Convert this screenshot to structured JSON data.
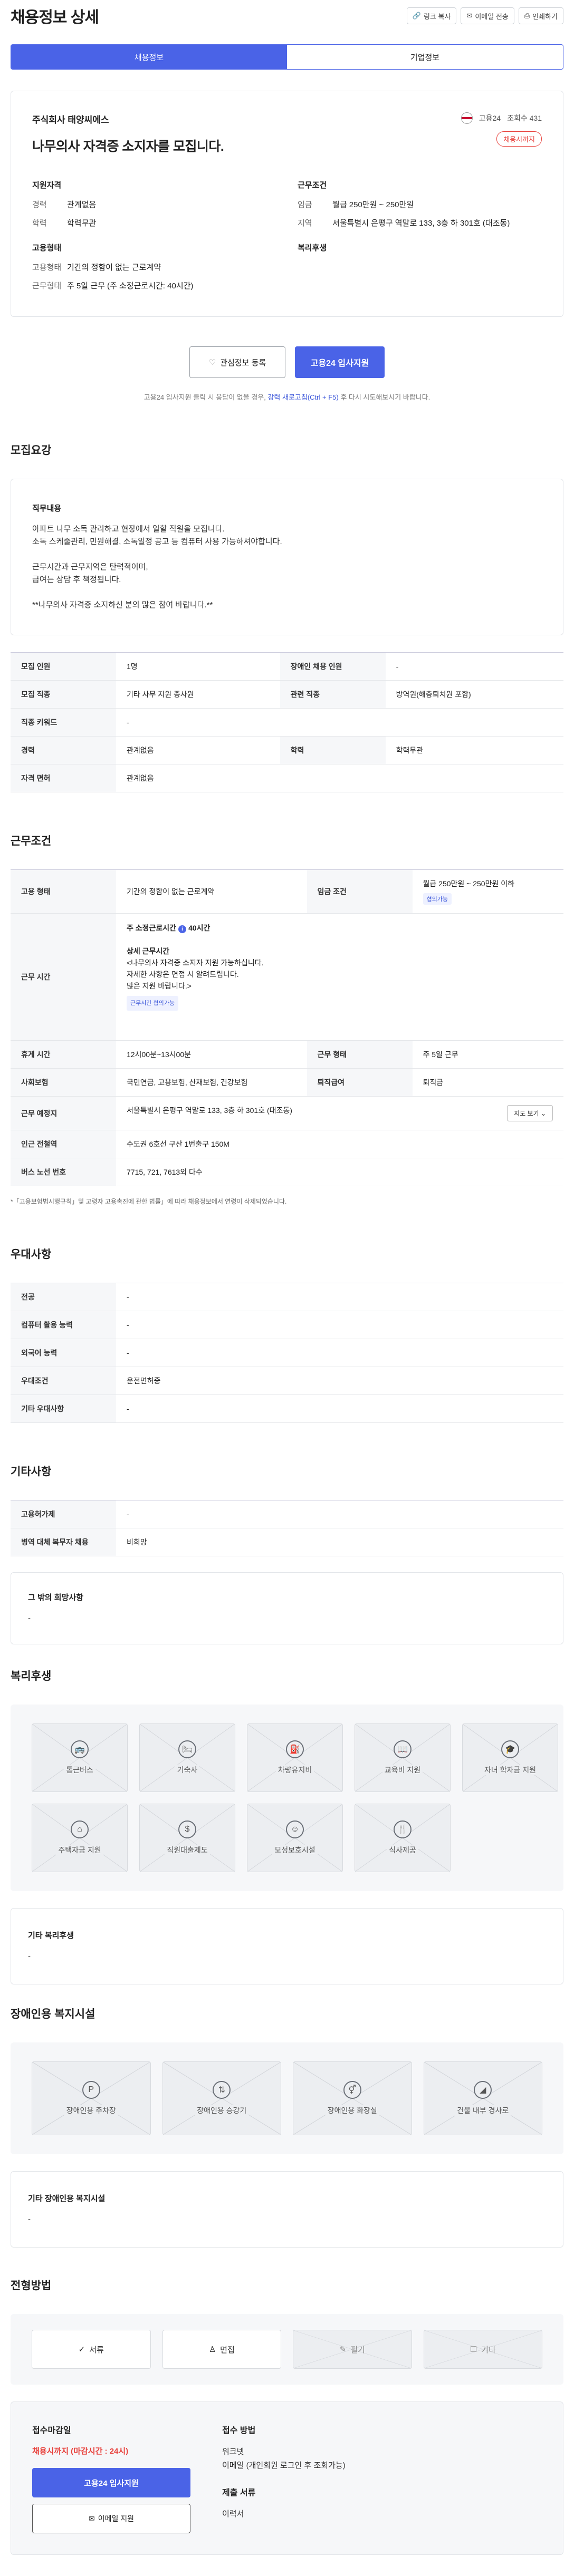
{
  "header": {
    "title": "채용정보 상세",
    "link_copy": "링크 복사",
    "email_send": "이메일 전송",
    "print": "인쇄하기"
  },
  "tabs": [
    "채용정보",
    "기업정보"
  ],
  "summary": {
    "company": "주식회사 태양씨에스",
    "title": "나무의사 자격증 소지자를 모집니다.",
    "worknet_label": "고용24",
    "views": "조회수 431",
    "badge": "채용시까지",
    "qual_title": "지원자격",
    "qual": [
      {
        "k": "경력",
        "v": "관계없음"
      },
      {
        "k": "학력",
        "v": "학력무관"
      }
    ],
    "cond_title": "근무조건",
    "cond": [
      {
        "k": "임금",
        "v": "월급 250만원 ~ 250만원"
      },
      {
        "k": "지역",
        "v": "서울특별시 은평구 역말로 133, 3층 하 301호 (대조동)"
      }
    ],
    "emp_title": "고용형태",
    "emp": [
      {
        "k": "고용형태",
        "v": "기간의 정함이 없는 근로계약"
      },
      {
        "k": "근무형태",
        "v": "주 5일 근무 (주 소정근로시간: 40시간)"
      }
    ],
    "welfare_title": "복리후생"
  },
  "actions": {
    "interest": "관심정보 등록",
    "apply": "고용24 입사지원"
  },
  "notice": {
    "pre": "고용24 입사지원 클릭 시 응답이 없을 경우, ",
    "link": "강력 새로고침(Ctrl + F5)",
    "post": " 후 다시 시도해보시기 바랍니다."
  },
  "recruit": {
    "section": "모집요강",
    "job_label": "직무내용",
    "job_lines": [
      "아파트 나무 소독 관리하고 현장에서 일할 직원을 모집니다.",
      "소독 스케줄관리, 민원해결, 소독일정 공고 등 컴퓨터 사용 가능하셔야합니다.",
      "",
      "근무시간과 근무지역은 탄력적이며,",
      "급여는 상담 후 책정됩니다.",
      "",
      "**나무의사 자격증 소지하신 분의 많은 참여 바랍니다.**"
    ],
    "rows": [
      [
        "모집 인원",
        "1명",
        "장애인 채용 인원",
        "-"
      ],
      [
        "모집 직종",
        "기타 사무 지원 종사원",
        "관련 직종",
        "방역원(해충퇴치원 포함)"
      ],
      [
        "직종 키워드",
        "-",
        "",
        ""
      ],
      [
        "경력",
        "관계없음",
        "학력",
        "학력무관"
      ],
      [
        "자격 면허",
        "관계없음",
        "",
        ""
      ]
    ]
  },
  "conditions": {
    "section": "근무조건",
    "emp_type_k": "고용 형태",
    "emp_type_v": "기간의 정함이 없는 근로계약",
    "wage_k": "임금 조건",
    "wage_v": "월급 250만원 ~ 250만원 이하",
    "wage_tag": "협의가능",
    "time_k": "근무 시간",
    "time_top": "주 소정근로시간",
    "time_hours": "40시간",
    "time_detail_title": "상세 근무시간",
    "time_lines": [
      "<나무의사 자격증 소지자 지원 가능하십니다.",
      "자세한 사항은 면접 시 알려드립니다.",
      "많은 지원 바랍니다.>"
    ],
    "time_tag": "근무시간 협의가능",
    "rows": [
      [
        "휴게 시간",
        "12시00분~13시00분",
        "근무 형태",
        "주 5일 근무"
      ],
      [
        "사회보험",
        "국민연금, 고용보험, 산재보험, 건강보험",
        "퇴직급여",
        "퇴직금"
      ]
    ],
    "place_k": "근무 예정지",
    "place_v": "서울특별시 은평구 역말로 133, 3층 하 301호 (대조동)",
    "map_btn": "지도 보기",
    "subway_k": "인근 전철역",
    "subway_v": "수도권 6호선 구산 1번출구 150M",
    "bus_k": "버스 노선 번호",
    "bus_v": "7715, 721, 7613외 다수",
    "footnote": "*「고용보험법시행규칙」및 고령자 고용촉진에 관한 법률」에 따라 채용정보에서 연령이 삭제되었습니다."
  },
  "preference": {
    "section": "우대사항",
    "rows": [
      [
        "전공",
        "-"
      ],
      [
        "컴퓨터 활용 능력",
        "-"
      ],
      [
        "외국어 능력",
        "-"
      ],
      [
        "우대조건",
        "운전면허증"
      ],
      [
        "기타 우대사항",
        "-"
      ]
    ]
  },
  "etc": {
    "section": "기타사항",
    "rows": [
      [
        "고용허가제",
        "-"
      ],
      [
        "병역 대체 복무자 채용",
        "비희망"
      ]
    ],
    "other_title": "그 밖의 희망사항",
    "other_value": "-"
  },
  "welfare": {
    "section": "복리후생",
    "items": [
      {
        "label": "통근버스",
        "icon": "bus-icon",
        "glyph": "🚌"
      },
      {
        "label": "기숙사",
        "icon": "bed-icon",
        "glyph": "🛏"
      },
      {
        "label": "차량유지비",
        "icon": "fuel-icon",
        "glyph": "⛽"
      },
      {
        "label": "교육비 지원",
        "icon": "book-icon",
        "glyph": "📖"
      },
      {
        "label": "자녀 학자금 지원",
        "icon": "graduation-icon",
        "glyph": "🎓"
      },
      {
        "label": "주택자금 지원",
        "icon": "house-icon",
        "glyph": "⌂"
      },
      {
        "label": "직원대출제도",
        "icon": "money-bag-icon",
        "glyph": "$"
      },
      {
        "label": "모성보호시설",
        "icon": "baby-icon",
        "glyph": "☺"
      },
      {
        "label": "식사제공",
        "icon": "meal-icon",
        "glyph": "🍴"
      }
    ],
    "other_title": "기타 복리후생",
    "other_value": "-"
  },
  "disability": {
    "section": "장애인용 복지시설",
    "items": [
      {
        "label": "장애인용 주차장",
        "icon": "parking-icon",
        "glyph": "P"
      },
      {
        "label": "장애인용 승강기",
        "icon": "elevator-icon",
        "glyph": "⇅"
      },
      {
        "label": "장애인용 화장실",
        "icon": "restroom-icon",
        "glyph": "⚥"
      },
      {
        "label": "건물 내부 경사로",
        "icon": "ramp-icon",
        "glyph": "◢"
      }
    ],
    "other_title": "기타 장애인용 복지시설",
    "other_value": "-"
  },
  "method": {
    "section": "전형방법",
    "items": [
      {
        "label": "서류",
        "icon": "document-check-icon",
        "glyph": "✓",
        "active": true
      },
      {
        "label": "면접",
        "icon": "person-icon",
        "glyph": "♙",
        "active": true
      },
      {
        "label": "필기",
        "icon": "pen-icon",
        "glyph": "✎",
        "active": false
      },
      {
        "label": "기타",
        "icon": "chat-icon",
        "glyph": "☐",
        "active": false
      }
    ]
  },
  "apply": {
    "deadline_title": "접수마감일",
    "deadline": "채용시까지 (마감시간 : 24시)",
    "apply_btn": "고용24 입사지원",
    "email_btn": "이메일 지원",
    "how_title": "접수 방법",
    "how_lines": [
      "워크넷",
      "이메일 (개인회원 로그인 후 조회가능)"
    ],
    "docs_title": "제출 서류",
    "docs_value": "이력서"
  }
}
